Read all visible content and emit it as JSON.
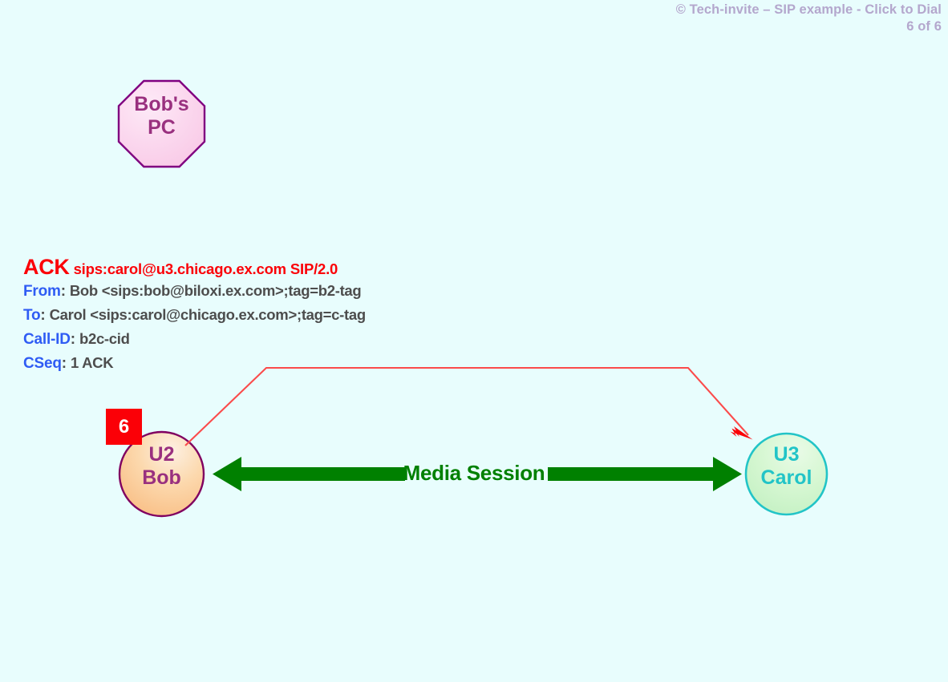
{
  "header": {
    "title": "© Tech-invite – SIP example - Click to Dial",
    "page": "6 of 6"
  },
  "sip_message": {
    "method": "ACK",
    "request_uri": "sips:carol@u3.chicago.ex.com SIP/2.0",
    "headers": [
      {
        "name": "From",
        "colon": ":",
        "value": "Bob <sips:bob@biloxi.ex.com>;tag=b2-tag"
      },
      {
        "name": "To",
        "colon": ":",
        "value": "Carol <sips:carol@chicago.ex.com>;tag=c-tag"
      },
      {
        "name": "Call-ID",
        "colon": ":",
        "value": "b2c-cid"
      },
      {
        "name": "CSeq",
        "colon": ":",
        "value": "1 ACK"
      }
    ]
  },
  "nodes": {
    "bobs_pc": {
      "line1": "Bob's",
      "line2": "PC",
      "shape": "octagon",
      "fill": "#fbd7ee",
      "stroke": "#800080",
      "text_color": "#99307f"
    },
    "u2_bob": {
      "line1": "U2",
      "line2": "Bob",
      "shape": "circle",
      "fill": "#fbc58c",
      "stroke": "#800060",
      "text_color": "#99307f"
    },
    "u3_carol": {
      "line1": "U3",
      "line2": "Carol",
      "shape": "circle",
      "fill": "#cdf5cb",
      "stroke": "#22c4c7",
      "text_color": "#22c4c7"
    }
  },
  "step_badge": {
    "number": "6",
    "background": "#fb0007",
    "text_color": "#ffffff"
  },
  "media_session": {
    "label": "Media Session",
    "color": "#008000"
  },
  "signal": {
    "name": "ACK",
    "color": "#fb0007",
    "direction": "u2-to-u3"
  },
  "colors": {
    "background": "#e8fdfd",
    "header_text": "#b4a7cd",
    "sip_header_name": "#2f5cf4",
    "sip_header_value": "#4d4d4d"
  }
}
